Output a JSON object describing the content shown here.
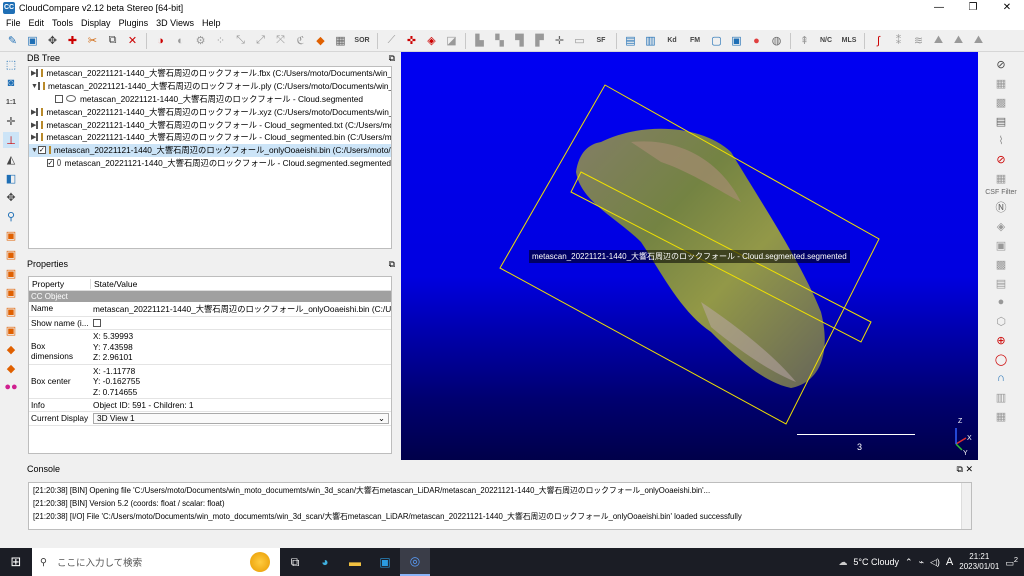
{
  "window": {
    "title": "CloudCompare v2.12 beta Stereo [64-bit]",
    "app_icon_text": "CC",
    "controls": [
      "—",
      "❐",
      "✕"
    ]
  },
  "menu": [
    "File",
    "Edit",
    "Tools",
    "Display",
    "Plugins",
    "3D Views",
    "Help"
  ],
  "toolbar": {
    "text_buttons": {
      "sor": "SOR",
      "sf": "SF",
      "kd": "Kd",
      "fm": "FM",
      "nc": "N/C",
      "mls": "MLS"
    }
  },
  "right_toolbar": {
    "csf_label": "CSF Filter"
  },
  "db_tree": {
    "title": "DB Tree",
    "rows": [
      {
        "arrow": "▶",
        "checked": false,
        "icon": "folder",
        "indent": 0,
        "label": "metascan_20221121-1440_大響石周辺のロックフォール.fbx (C:/Users/moto/Documents/win_...",
        "selected": false
      },
      {
        "arrow": "▼",
        "checked": false,
        "icon": "folder",
        "indent": 0,
        "label": "metascan_20221121-1440_大響石周辺のロックフォール.ply (C:/Users/moto/Documents/win_...",
        "selected": false
      },
      {
        "arrow": "",
        "checked": false,
        "icon": "cloud",
        "indent": 1,
        "label": "metascan_20221121-1440_大響石周辺のロックフォール - Cloud.segmented",
        "selected": false
      },
      {
        "arrow": "▶",
        "checked": false,
        "icon": "folder",
        "indent": 0,
        "label": "metascan_20221121-1440_大響石周辺のロックフォール.xyz (C:/Users/moto/Documents/win_...",
        "selected": false
      },
      {
        "arrow": "▶",
        "checked": false,
        "icon": "folder",
        "indent": 0,
        "label": "metascan_20221121-1440_大響石周辺のロックフォール - Cloud_segmented.txt (C:/Users/mot...",
        "selected": false
      },
      {
        "arrow": "▶",
        "checked": false,
        "icon": "folder",
        "indent": 0,
        "label": "metascan_20221121-1440_大響石周辺のロックフォール - Cloud_segmented.bin (C:/Users/mot...",
        "selected": false
      },
      {
        "arrow": "▼",
        "checked": true,
        "icon": "folder",
        "indent": 0,
        "label": "metascan_20221121-1440_大響石周辺のロックフォール_onlyOoaeishi.bin (C:/Users/moto/Do...",
        "selected": true
      },
      {
        "arrow": "",
        "checked": true,
        "icon": "cloud",
        "indent": 1,
        "label": "metascan_20221121-1440_大響石周辺のロックフォール - Cloud.segmented.segmented",
        "selected": false
      }
    ]
  },
  "properties": {
    "title": "Properties",
    "col_property": "Property",
    "col_value": "State/Value",
    "section": "CC Object",
    "name_key": "Name",
    "name_value": "metascan_20221121-1440_大響石周辺のロックフォール_onlyOoaeishi.bin (C:/Users/mo...",
    "show_name_key": "Show name (i...",
    "box_dim_key": "Box dimensions",
    "box_dim": {
      "x": "X: 5.39993",
      "y": "Y: 7.43598",
      "z": "Z: 2.96101"
    },
    "box_center_key": "Box center",
    "box_center": {
      "x": "X: -1.11778",
      "y": "Y: -0.162755",
      "z": "Z: 0.714655"
    },
    "info_key": "Info",
    "info_value": "Object ID: 591 - Children: 1",
    "display_key": "Current Display",
    "display_value": "3D View 1"
  },
  "view3d": {
    "object_label": "metascan_20221121-1440_大響石周辺のロックフォール - Cloud.segmented.segmented",
    "scale_value": "3",
    "axis_x": "X",
    "axis_y": "Y",
    "axis_z": "Z"
  },
  "console": {
    "title": "Console",
    "lines": [
      "[21:20:38] [BIN] Opening file 'C:/Users/moto/Documents/win_moto_documemts/win_3d_scan/大響石metascan_LiDAR/metascan_20221121-1440_大響石周辺のロックフォール_onlyOoaeishi.bin'...",
      "[21:20:38] [BIN] Version 5.2 (coords: float / scalar: float)",
      "[21:20:38] [I/O] File 'C:/Users/moto/Documents/win_moto_documemts/win_3d_scan/大響石metascan_LiDAR/metascan_20221121-1440_大響石周辺のロックフォール_onlyOoaeishi.bin' loaded successfully"
    ]
  },
  "taskbar": {
    "search_placeholder": "ここに入力して検索",
    "weather": "5°C  Cloudy",
    "ime": "A",
    "time": "21:21",
    "date": "2023/01/01",
    "notification_count": "2"
  }
}
